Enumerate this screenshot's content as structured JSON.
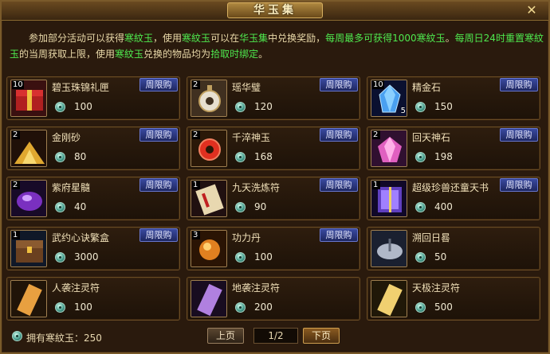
{
  "window": {
    "title": "华玉集",
    "close_glyph": "✕"
  },
  "info": {
    "p1": "参加部分活动可以获得",
    "c1": "寒紋玉",
    "p2": "，使用",
    "c2": "寒紋玉",
    "p3": "可以在",
    "c3": "华玉集",
    "p4": "中兑换奖励，",
    "c4": "每周最多可获得1000寒紋玉",
    "p5": "。",
    "c5": "每周日24时重置",
    "c6": "寒紋玉",
    "p6": "的当周获取上限，使用",
    "c7": "寒紋玉",
    "p7": "兑换的物品均为",
    "c8": "拾取时绑定",
    "p8": "。"
  },
  "items": [
    {
      "name": "碧玉珠锦礼匣",
      "price": "100",
      "qty": "10",
      "qty2": "",
      "tag": "周限购",
      "icon": "red-gift-box-icon"
    },
    {
      "name": "瑶华璧",
      "price": "120",
      "qty": "2",
      "qty2": "",
      "tag": "周限购",
      "icon": "jade-disc-icon"
    },
    {
      "name": "精金石",
      "price": "150",
      "qty": "10",
      "qty2": "5",
      "tag": "周限购",
      "icon": "blue-crystal-icon"
    },
    {
      "name": "金刚砂",
      "price": "80",
      "qty": "2",
      "qty2": "",
      "tag": "周限购",
      "icon": "gold-sand-icon"
    },
    {
      "name": "千淬神玉",
      "price": "168",
      "qty": "2",
      "qty2": "",
      "tag": "周限购",
      "icon": "red-ring-jade-icon"
    },
    {
      "name": "回天神石",
      "price": "198",
      "qty": "2",
      "qty2": "",
      "tag": "周限购",
      "icon": "pink-gem-icon"
    },
    {
      "name": "紫府星髓",
      "price": "40",
      "qty": "2",
      "qty2": "",
      "tag": "周限购",
      "icon": "purple-essence-icon"
    },
    {
      "name": "九天洗炼符",
      "price": "90",
      "qty": "1",
      "qty2": "",
      "tag": "周限购",
      "icon": "scroll-talisman-icon"
    },
    {
      "name": "超级珍兽还童天书",
      "price": "400",
      "qty": "1",
      "qty2": "",
      "tag": "周限购",
      "icon": "purple-book-icon"
    },
    {
      "name": "武约心诀繁盒",
      "price": "3000",
      "qty": "1",
      "qty2": "",
      "tag": "周限购",
      "icon": "treasure-chest-icon"
    },
    {
      "name": "功力丹",
      "price": "100",
      "qty": "3",
      "qty2": "",
      "tag": "周限购",
      "icon": "golden-pill-icon"
    },
    {
      "name": "溯回日晷",
      "price": "50",
      "qty": "",
      "qty2": "",
      "tag": "",
      "icon": "sundial-icon"
    },
    {
      "name": "人袭注灵符",
      "price": "100",
      "qty": "",
      "qty2": "",
      "tag": "",
      "icon": "orange-talisman-icon"
    },
    {
      "name": "地袭注灵符",
      "price": "200",
      "qty": "",
      "qty2": "",
      "tag": "",
      "icon": "purple-talisman-icon"
    },
    {
      "name": "天极注灵符",
      "price": "500",
      "qty": "",
      "qty2": "",
      "tag": "",
      "icon": "gold-talisman-icon"
    }
  ],
  "footer": {
    "owned_label": "拥有寒紋玉：250",
    "prev_label": "上页",
    "page_indicator": "1/2",
    "next_label": "下页"
  },
  "colors": {
    "highlight": "#4ee84e",
    "tag_bg": "#2a3a8a",
    "frame": "#7a5a2a"
  }
}
